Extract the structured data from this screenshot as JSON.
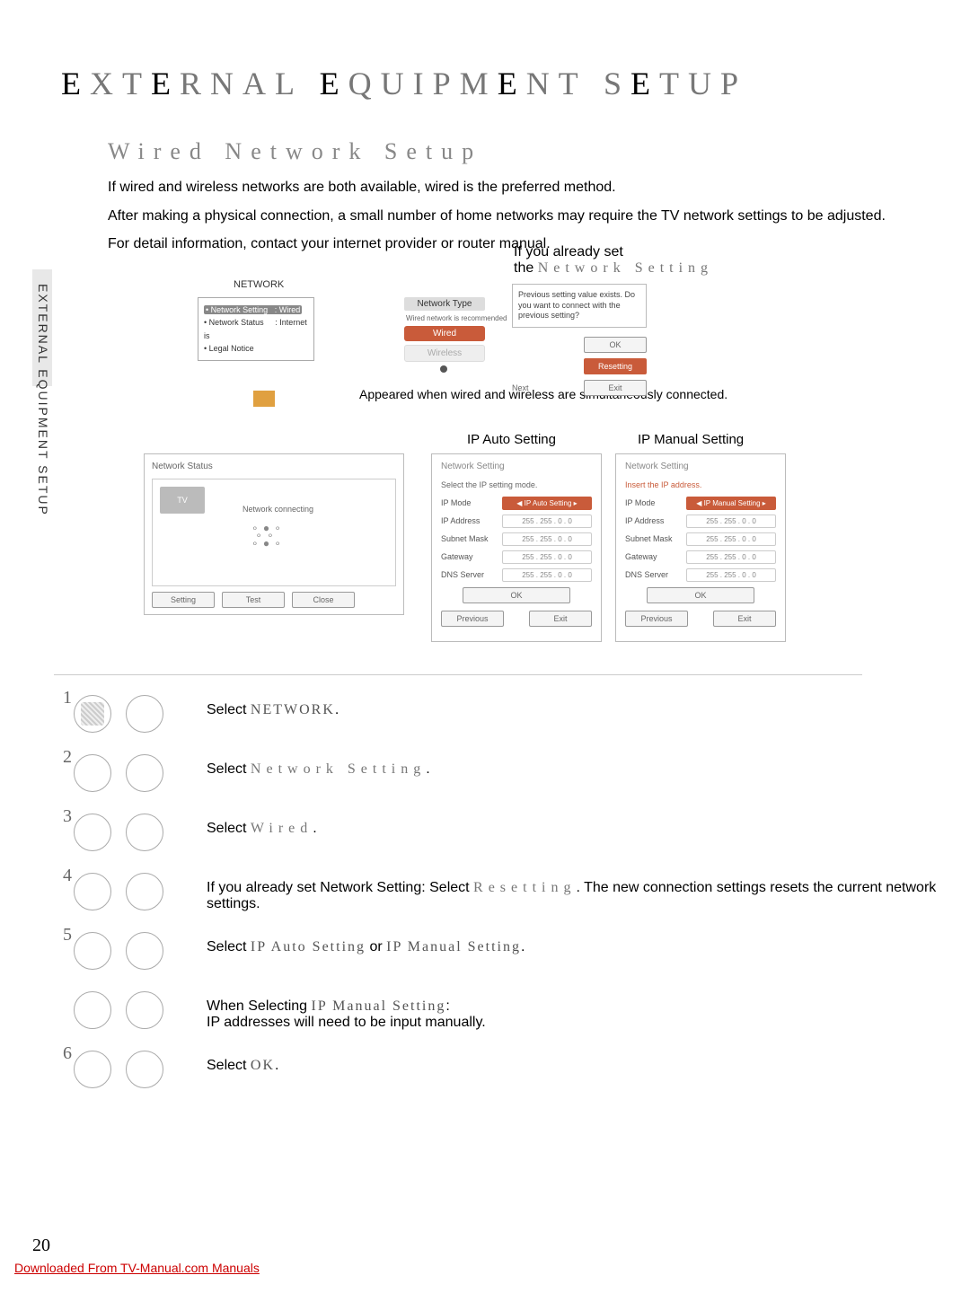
{
  "title_plain": "EXTERNAL EQUIPMENT SETUP",
  "subtitle": "Wired Network Setup",
  "intro_lines": [
    "If wired and wireless networks are both available, wired is the preferred method.",
    "After making a physical connection, a small number of home networks may require the TV network settings to be adjusted.",
    "For detail information, contact your internet provider or router manual."
  ],
  "already_set_prefix": "If you already set",
  "already_set_the": "the",
  "already_set_term": "Network Setting",
  "vert_label": "EXTERNAL EQUIPMENT SETUP",
  "network_panel": {
    "title": "NETWORK",
    "items": [
      {
        "label": "Network Setting",
        "value": ": Wired",
        "selected": true
      },
      {
        "label": "Network Status",
        "value": ": Internet is"
      },
      {
        "label": "Legal Notice",
        "value": ""
      }
    ],
    "type_label": "Network Type",
    "type_note": "Wired network is recommended",
    "wired_btn": "Wired",
    "wireless_btn": "Wireless"
  },
  "appeared_note": "Appeared when wired and wireless are simultaneously connected.",
  "prev_dialog": {
    "text": "Previous setting value exists. Do you want to connect with the previous setting?",
    "ok": "OK",
    "resetting": "Resetting",
    "next": "Next",
    "exit": "Exit"
  },
  "ip_auto_label": "IP Auto Setting",
  "ip_manual_label": "IP Manual Setting",
  "status_panel": {
    "title": "Network Status",
    "tv": "TV",
    "connecting": "Network connecting",
    "setting": "Setting",
    "test": "Test",
    "close": "Close"
  },
  "ip_panel_shared": {
    "panel_title": "Network Setting",
    "ip_mode": "IP Mode",
    "ip_address": "IP Address",
    "subnet": "Subnet Mask",
    "gateway": "Gateway",
    "dns": "DNS Server",
    "ok": "OK",
    "previous": "Previous",
    "exit": "Exit",
    "sample_ip_spaced": "255 . 255 . 0 . 0",
    "sample_ip_dotted": "255 . 255 . 0 . 0"
  },
  "ip_auto_panel": {
    "sub": "Select the IP setting mode.",
    "mode_val": "◀ IP Auto Setting ▸"
  },
  "ip_manual_panel": {
    "sub": "Insert the IP address.",
    "mode_val": "◀ IP Manual Setting ▸"
  },
  "steps": {
    "s1_a": "Select ",
    "s1_b": "NETWORK",
    "s1_c": ".",
    "s2_a": "Select ",
    "s2_b": "Network Setting",
    "s2_c": ".",
    "s3_a": "Select ",
    "s3_b": "Wired",
    "s3_c": ".",
    "s4_a": "If you already set Network Setting: Select ",
    "s4_b": "Resetting",
    "s4_c": ". The new connection settings resets the current network settings.",
    "s5_a": "Select ",
    "s5_b": "IP Auto Setting",
    "s5_or": " or ",
    "s5_c": "IP Manual Setting",
    "s5_d": ".",
    "s5b_a": "When Selecting ",
    "s5b_b": "IP Manual Setting",
    "s5b_c": ":",
    "s5b_d": "IP addresses will need to be input manually.",
    "s6_a": "Select ",
    "s6_b": "OK",
    "s6_c": "."
  },
  "page_number": "20",
  "footer": "Downloaded From TV-Manual.com Manuals"
}
